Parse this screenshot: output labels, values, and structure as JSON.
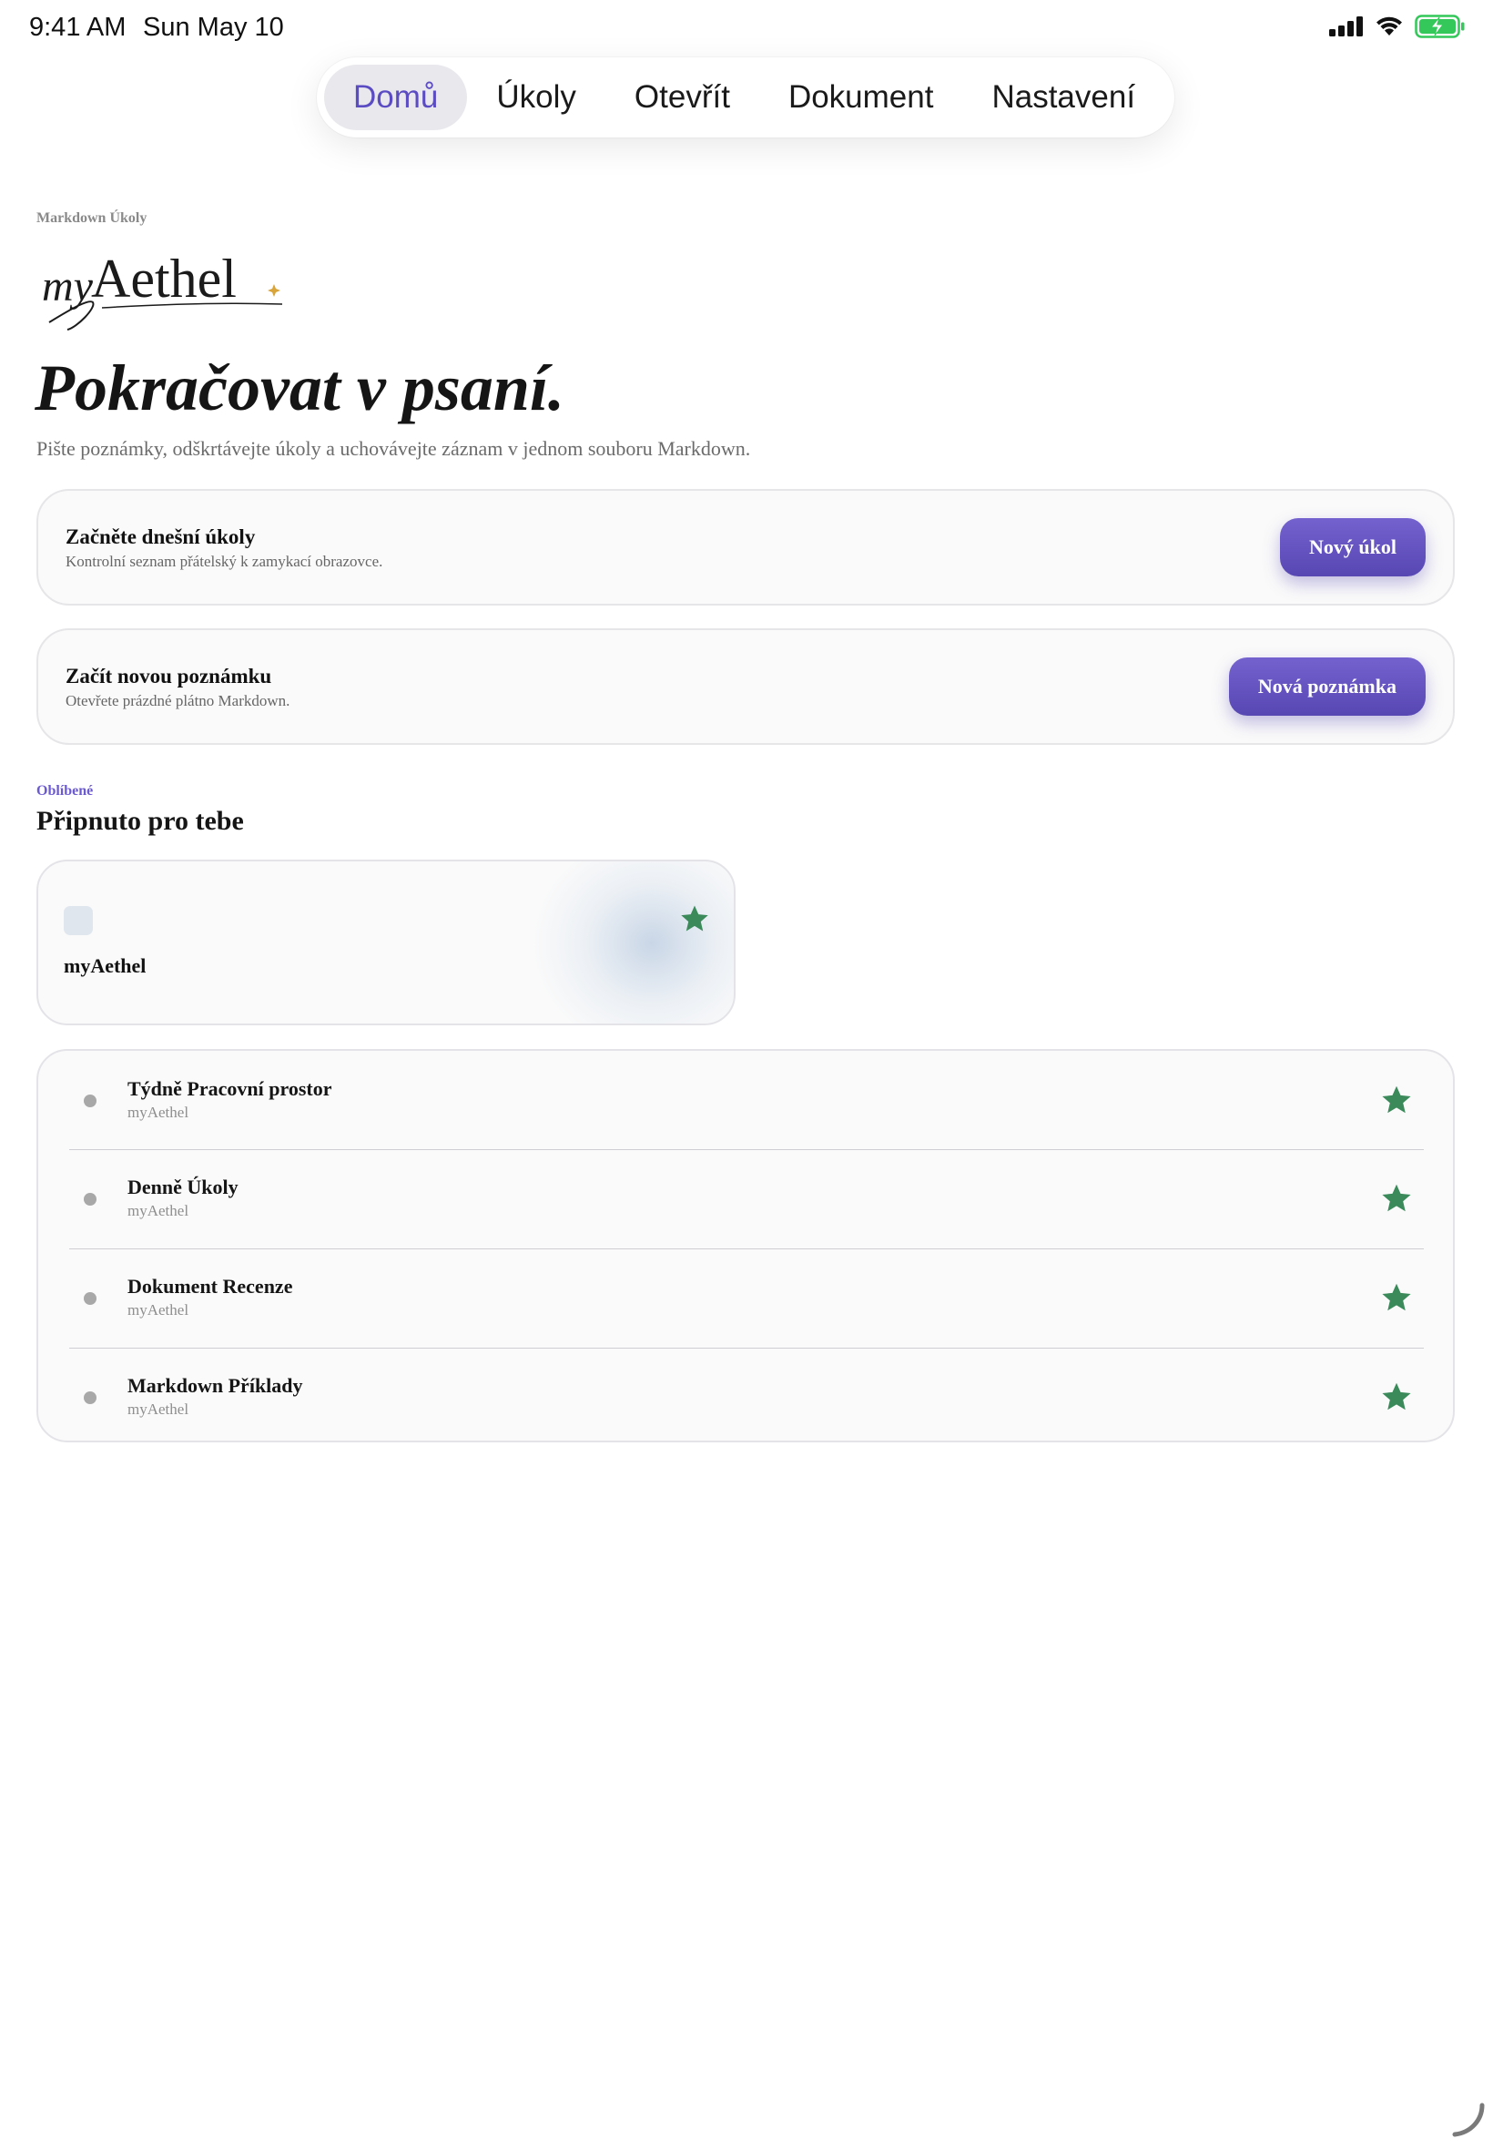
{
  "status_bar": {
    "time": "9:41 AM",
    "date": "Sun May 10",
    "icons": [
      "cellular-signal-icon",
      "wifi-icon",
      "battery-charging-icon"
    ],
    "battery_color": "#34c759"
  },
  "tabs": [
    {
      "label": "Domů",
      "active": true
    },
    {
      "label": "Úkoly",
      "active": false
    },
    {
      "label": "Otevřít",
      "active": false
    },
    {
      "label": "Dokument",
      "active": false
    },
    {
      "label": "Nastavení",
      "active": false
    }
  ],
  "header": {
    "kicker": "Markdown Úkoly",
    "logo_text": "myAethel",
    "title": "Pokračovat v psaní.",
    "subtitle": "Pište poznámky, odškrtávejte úkoly a uchovávejte záznam v jednom souboru Markdown."
  },
  "actions": [
    {
      "title": "Začněte dnešní úkoly",
      "description": "Kontrolní seznam přátelský k zamykací obrazovce.",
      "button": "Nový úkol"
    },
    {
      "title": "Začít novou poznámku",
      "description": "Otevřete prázdné plátno Markdown.",
      "button": "Nová poznámka"
    }
  ],
  "favorites": {
    "kicker": "Oblíbené",
    "title": "Připnuto pro tebe",
    "pinned": {
      "label": "myAethel",
      "starred": true
    },
    "items": [
      {
        "title": "Týdně Pracovní prostor",
        "subtitle": "myAethel",
        "starred": true
      },
      {
        "title": "Denně Úkoly",
        "subtitle": "myAethel",
        "starred": true
      },
      {
        "title": "Dokument Recenze",
        "subtitle": "myAethel",
        "starred": true
      },
      {
        "title": "Markdown Příklady",
        "subtitle": "myAethel",
        "starred": true
      }
    ]
  },
  "colors": {
    "accent": "#5b4cc4",
    "button": "#6554c0",
    "star": "#3a8a5a",
    "logo_sparkle": "#d9a43a"
  }
}
